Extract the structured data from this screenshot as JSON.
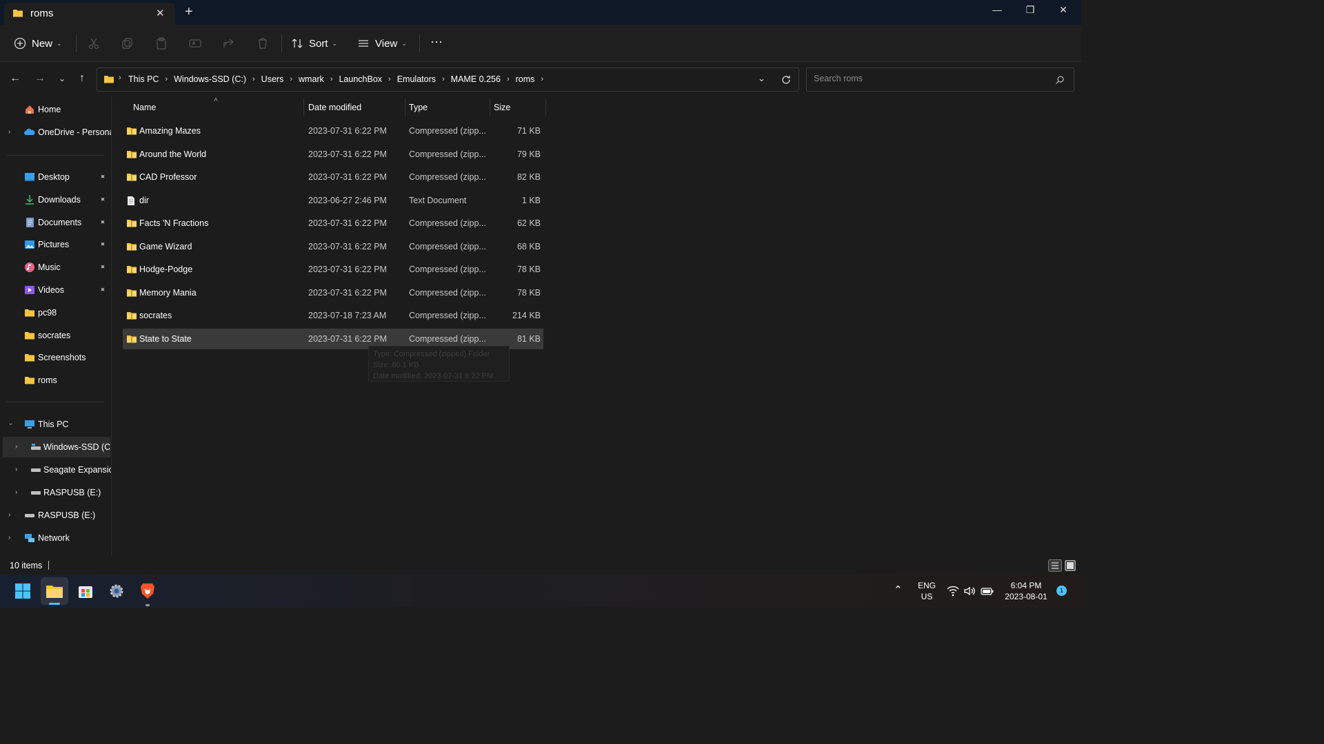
{
  "window": {
    "tab_title": "roms",
    "new_tab_label": "+",
    "minimize_label": "—",
    "maximize_label": "❐",
    "close_label": "✕"
  },
  "toolbar": {
    "new_label": "New",
    "sort_label": "Sort",
    "view_label": "View",
    "more_label": "···"
  },
  "breadcrumb": [
    "This PC",
    "Windows-SSD (C:)",
    "Users",
    "wmark",
    "LaunchBox",
    "Emulators",
    "MAME 0.256",
    "roms"
  ],
  "search": {
    "placeholder": "Search roms"
  },
  "sidebar": {
    "home": "Home",
    "onedrive": "OneDrive - Persona",
    "quick_access": [
      {
        "label": "Desktop",
        "icon": "desktop-icon",
        "pinned": true
      },
      {
        "label": "Downloads",
        "icon": "downloads-icon",
        "pinned": true
      },
      {
        "label": "Documents",
        "icon": "documents-icon",
        "pinned": true
      },
      {
        "label": "Pictures",
        "icon": "pictures-icon",
        "pinned": true
      },
      {
        "label": "Music",
        "icon": "music-icon",
        "pinned": true
      },
      {
        "label": "Videos",
        "icon": "videos-icon",
        "pinned": true
      },
      {
        "label": "pc98",
        "icon": "folder-icon",
        "pinned": false
      },
      {
        "label": "socrates",
        "icon": "folder-icon",
        "pinned": false
      },
      {
        "label": "Screenshots",
        "icon": "folder-icon",
        "pinned": false
      },
      {
        "label": "roms",
        "icon": "folder-icon",
        "pinned": false
      }
    ],
    "this_pc": "This PC",
    "drives": [
      "Windows-SSD (C:)",
      "Seagate Expansio",
      "RASPUSB (E:)"
    ],
    "raspusb": "RASPUSB (E:)",
    "network": "Network"
  },
  "columns": {
    "name": "Name",
    "date": "Date modified",
    "type": "Type",
    "size": "Size"
  },
  "files": [
    {
      "name": "Amazing Mazes",
      "date": "2023-07-31 6:22 PM",
      "type": "Compressed (zipp...",
      "size": "71 KB",
      "icon": "zip-folder-icon"
    },
    {
      "name": "Around the World",
      "date": "2023-07-31 6:22 PM",
      "type": "Compressed (zipp...",
      "size": "79 KB",
      "icon": "zip-folder-icon"
    },
    {
      "name": "CAD Professor",
      "date": "2023-07-31 6:22 PM",
      "type": "Compressed (zipp...",
      "size": "82 KB",
      "icon": "zip-folder-icon"
    },
    {
      "name": "dir",
      "date": "2023-06-27 2:46 PM",
      "type": "Text Document",
      "size": "1 KB",
      "icon": "text-document-icon"
    },
    {
      "name": "Facts 'N Fractions",
      "date": "2023-07-31 6:22 PM",
      "type": "Compressed (zipp...",
      "size": "62 KB",
      "icon": "zip-folder-icon"
    },
    {
      "name": "Game Wizard",
      "date": "2023-07-31 6:22 PM",
      "type": "Compressed (zipp...",
      "size": "68 KB",
      "icon": "zip-folder-icon"
    },
    {
      "name": "Hodge-Podge",
      "date": "2023-07-31 6:22 PM",
      "type": "Compressed (zipp...",
      "size": "78 KB",
      "icon": "zip-folder-icon"
    },
    {
      "name": "Memory Mania",
      "date": "2023-07-31 6:22 PM",
      "type": "Compressed (zipp...",
      "size": "78 KB",
      "icon": "zip-folder-icon"
    },
    {
      "name": "socrates",
      "date": "2023-07-18 7:23 AM",
      "type": "Compressed (zipp...",
      "size": "214 KB",
      "icon": "zip-folder-icon"
    },
    {
      "name": "State to State",
      "date": "2023-07-31 6:22 PM",
      "type": "Compressed (zipp...",
      "size": "81 KB",
      "icon": "zip-folder-icon",
      "selected": true
    }
  ],
  "tooltip": {
    "type": "Type: Compressed (zipped) Folder",
    "size": "Size: 80.1 KB",
    "date": "Date modified: 2023-07-31 6:22 PM"
  },
  "status": {
    "item_count": "10 items"
  },
  "taskbar": {
    "lang": "ENG",
    "region": "US",
    "time": "6:04 PM",
    "date": "2023-08-01",
    "notification_count": "1"
  },
  "colors": {
    "accent": "#4cc2ff",
    "folder": "#f4c542",
    "selection": "#3a3a3a"
  }
}
